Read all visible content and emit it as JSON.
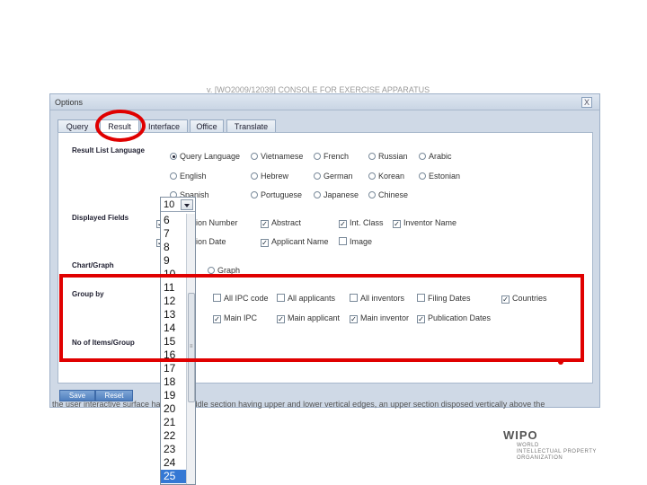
{
  "window": {
    "behind_title": "v. [WO2009/12039] CONSOLE FOR EXERCISE APPARATUS",
    "title": "Options",
    "close_glyph": "X"
  },
  "tabs": [
    {
      "label": "Query"
    },
    {
      "label": "Result"
    },
    {
      "label": "Interface"
    },
    {
      "label": "Office"
    },
    {
      "label": "Translate"
    }
  ],
  "sections": {
    "result_language": "Result List Language",
    "displayed_fields": "Displayed Fields",
    "chart_graph": "Chart/Graph",
    "group_by": "Group by",
    "no_items": "No of Items/Group"
  },
  "languages": [
    {
      "label": "Query Language",
      "selected": true
    },
    {
      "label": "Vietnamese"
    },
    {
      "label": "French"
    },
    {
      "label": "Russian"
    },
    {
      "label": "Arabic"
    },
    {
      "label": "English"
    },
    {
      "label": "Hebrew"
    },
    {
      "label": "German"
    },
    {
      "label": "Korean"
    },
    {
      "label": "Estonian"
    },
    {
      "label": "Spanish"
    },
    {
      "label": "Portuguese"
    },
    {
      "label": "Japanese"
    },
    {
      "label": "Chinese"
    }
  ],
  "displayed_fields": [
    {
      "label": "Application Number",
      "checked": true
    },
    {
      "label": "Abstract",
      "checked": true
    },
    {
      "label": "Int. Class",
      "checked": true
    },
    {
      "label": "Inventor Name",
      "checked": true
    },
    {
      "label": "Publication Date",
      "checked": true
    },
    {
      "label": "Applicant Name",
      "checked": true
    },
    {
      "label": "Image",
      "checked": false
    }
  ],
  "chart_graph": {
    "graph_label": "Graph"
  },
  "group_by": [
    {
      "label": "All IPC code",
      "checked": false
    },
    {
      "label": "All applicants",
      "checked": false
    },
    {
      "label": "All inventors",
      "checked": false
    },
    {
      "label": "Filing Dates",
      "checked": false
    },
    {
      "label": "Countries",
      "checked": true
    },
    {
      "label": "Main IPC",
      "checked": true
    },
    {
      "label": "Main applicant",
      "checked": true
    },
    {
      "label": "Main inventor",
      "checked": true
    },
    {
      "label": "Publication Dates",
      "checked": true
    }
  ],
  "dropdown": {
    "value": "10",
    "options": [
      "6",
      "7",
      "8",
      "9",
      "10",
      "11",
      "12",
      "13",
      "14",
      "15",
      "16",
      "17",
      "18",
      "19",
      "20",
      "21",
      "22",
      "23",
      "24",
      "25"
    ],
    "highlighted": "25"
  },
  "buttons": {
    "save": "Save",
    "reset": "Reset"
  },
  "bottom_text": "the user interactive surface having a middle section having upper and lower vertical edges, an upper section disposed vertically above the",
  "logo": {
    "name": "WIPO",
    "line1": "WORLD",
    "line2": "INTELLECTUAL PROPERTY",
    "line3": "ORGANIZATION"
  },
  "colors": {
    "annotation_red": "#e00000",
    "selection_blue": "#3478d4",
    "dialog_bg": "#cfd9e6"
  }
}
